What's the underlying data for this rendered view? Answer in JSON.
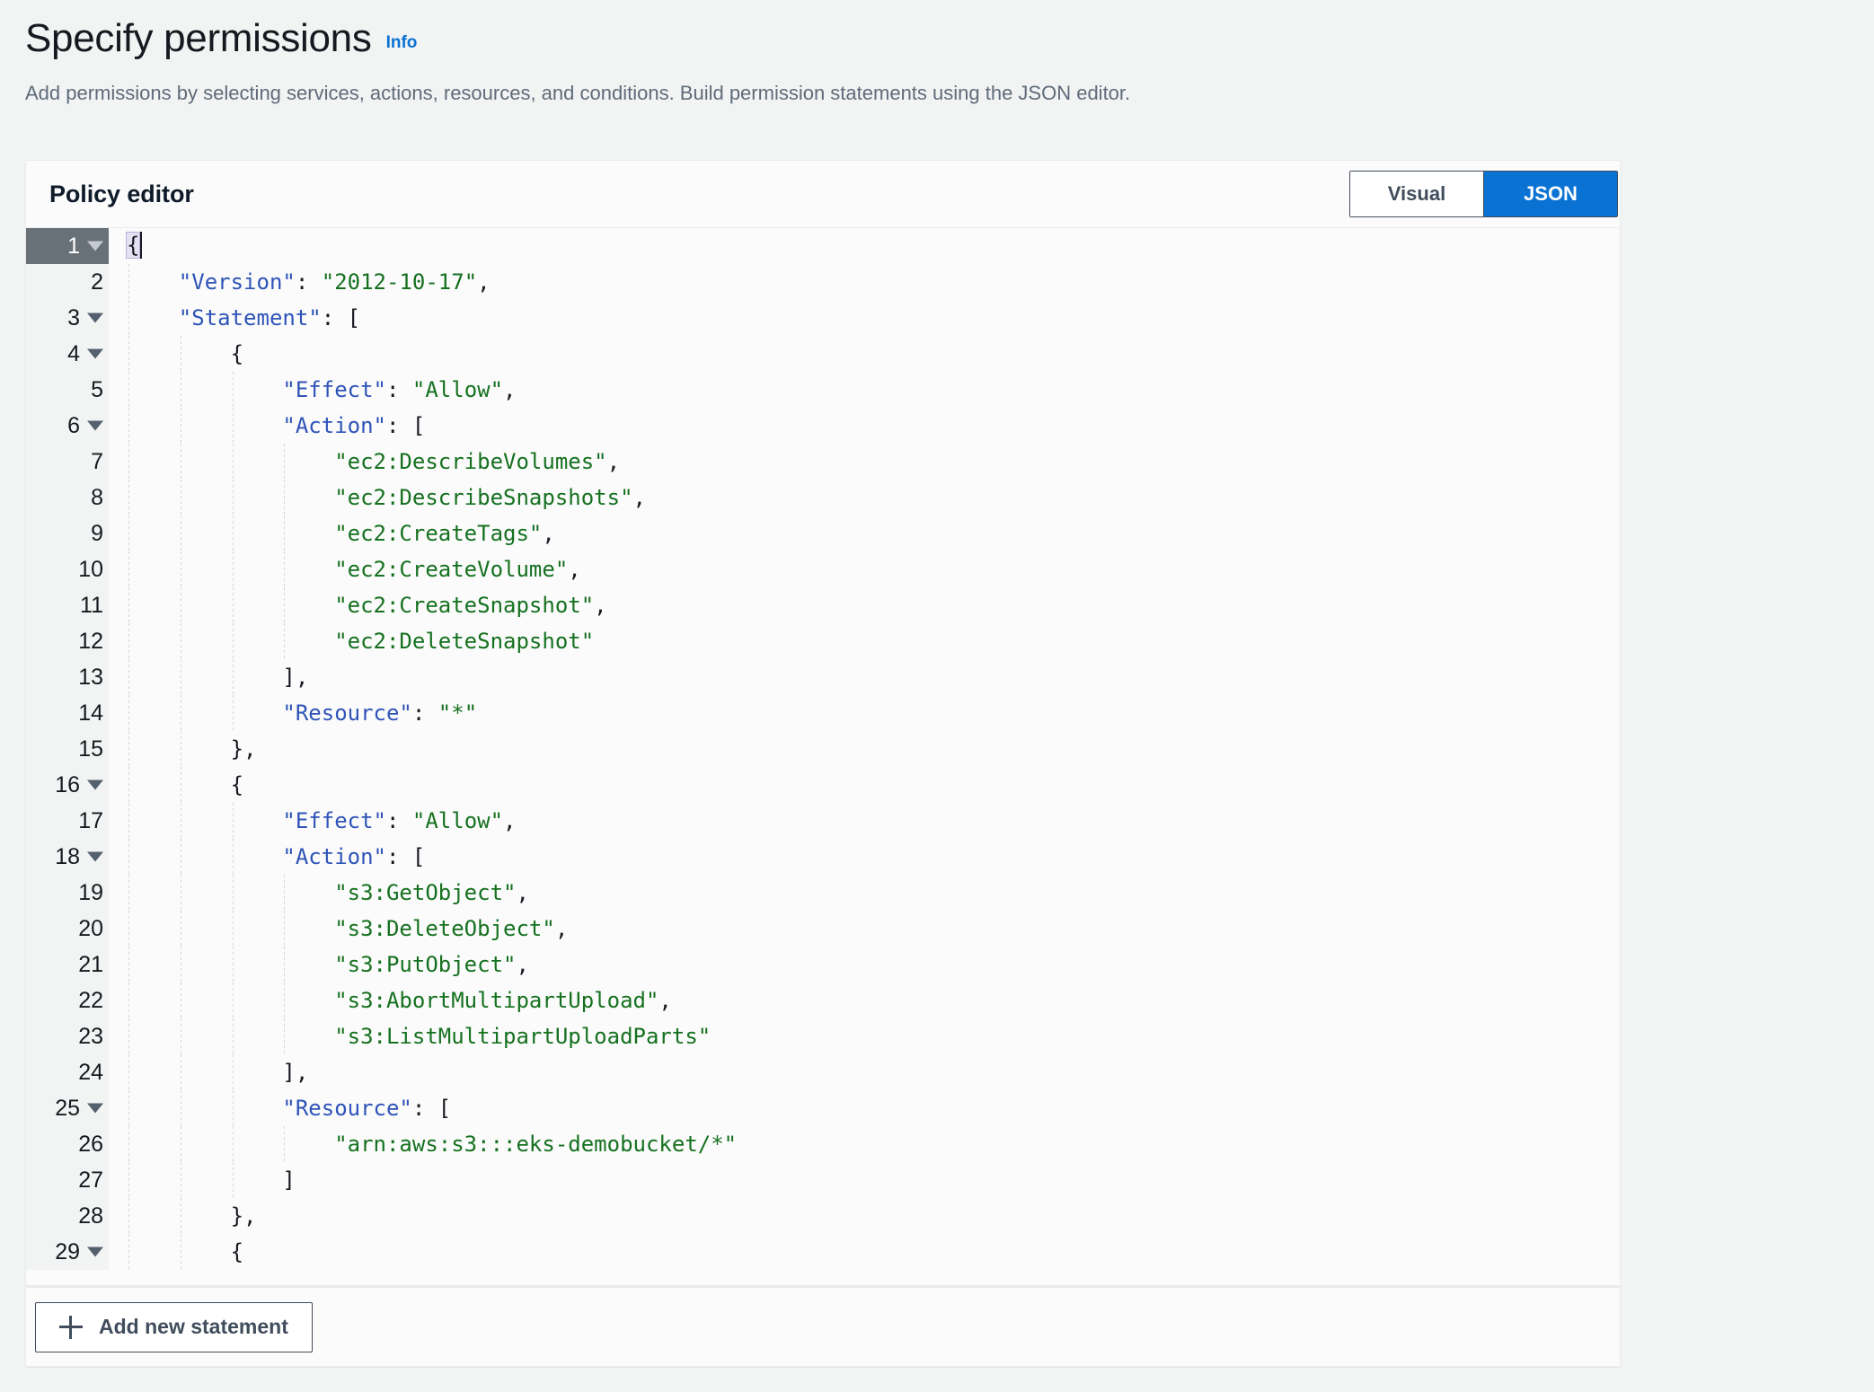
{
  "header": {
    "title": "Specify permissions",
    "info_label": "Info",
    "subtitle": "Add permissions by selecting services, actions, resources, and conditions. Build permission statements using the JSON editor."
  },
  "policy_editor": {
    "heading": "Policy editor",
    "mode_toggle": {
      "options": [
        "Visual",
        "JSON"
      ],
      "visual_label": "Visual",
      "json_label": "JSON",
      "selected": "JSON",
      "active_color": "#0972d3",
      "inactive_color": "#ffffff"
    },
    "footer": {
      "add_statement_label": "Add new statement",
      "add_icon": "plus-icon"
    },
    "syntax_colors": {
      "key": "#2f54b8",
      "string": "#15711f",
      "punctuation": "#16191f",
      "gutter_bg": "#f2f3f3",
      "active_line_bg": "#687078"
    },
    "active_line": 1,
    "lines": [
      {
        "n": 1,
        "indent": 0,
        "fold": true,
        "text": "{",
        "active": true
      },
      {
        "n": 2,
        "indent": 1,
        "fold": false,
        "text": "\"Version\": \"2012-10-17\","
      },
      {
        "n": 3,
        "indent": 1,
        "fold": true,
        "text": "\"Statement\": ["
      },
      {
        "n": 4,
        "indent": 2,
        "fold": true,
        "text": "{"
      },
      {
        "n": 5,
        "indent": 3,
        "fold": false,
        "text": "\"Effect\": \"Allow\","
      },
      {
        "n": 6,
        "indent": 3,
        "fold": true,
        "text": "\"Action\": ["
      },
      {
        "n": 7,
        "indent": 4,
        "fold": false,
        "text": "\"ec2:DescribeVolumes\","
      },
      {
        "n": 8,
        "indent": 4,
        "fold": false,
        "text": "\"ec2:DescribeSnapshots\","
      },
      {
        "n": 9,
        "indent": 4,
        "fold": false,
        "text": "\"ec2:CreateTags\","
      },
      {
        "n": 10,
        "indent": 4,
        "fold": false,
        "text": "\"ec2:CreateVolume\","
      },
      {
        "n": 11,
        "indent": 4,
        "fold": false,
        "text": "\"ec2:CreateSnapshot\","
      },
      {
        "n": 12,
        "indent": 4,
        "fold": false,
        "text": "\"ec2:DeleteSnapshot\""
      },
      {
        "n": 13,
        "indent": 3,
        "fold": false,
        "text": "],"
      },
      {
        "n": 14,
        "indent": 3,
        "fold": false,
        "text": "\"Resource\": \"*\""
      },
      {
        "n": 15,
        "indent": 2,
        "fold": false,
        "text": "},"
      },
      {
        "n": 16,
        "indent": 2,
        "fold": true,
        "text": "{"
      },
      {
        "n": 17,
        "indent": 3,
        "fold": false,
        "text": "\"Effect\": \"Allow\","
      },
      {
        "n": 18,
        "indent": 3,
        "fold": true,
        "text": "\"Action\": ["
      },
      {
        "n": 19,
        "indent": 4,
        "fold": false,
        "text": "\"s3:GetObject\","
      },
      {
        "n": 20,
        "indent": 4,
        "fold": false,
        "text": "\"s3:DeleteObject\","
      },
      {
        "n": 21,
        "indent": 4,
        "fold": false,
        "text": "\"s3:PutObject\","
      },
      {
        "n": 22,
        "indent": 4,
        "fold": false,
        "text": "\"s3:AbortMultipartUpload\","
      },
      {
        "n": 23,
        "indent": 4,
        "fold": false,
        "text": "\"s3:ListMultipartUploadParts\""
      },
      {
        "n": 24,
        "indent": 3,
        "fold": false,
        "text": "],"
      },
      {
        "n": 25,
        "indent": 3,
        "fold": true,
        "text": "\"Resource\": ["
      },
      {
        "n": 26,
        "indent": 4,
        "fold": false,
        "text": "\"arn:aws:s3:::eks-demobucket/*\""
      },
      {
        "n": 27,
        "indent": 3,
        "fold": false,
        "text": "]"
      },
      {
        "n": 28,
        "indent": 2,
        "fold": false,
        "text": "},"
      },
      {
        "n": 29,
        "indent": 2,
        "fold": true,
        "text": "{"
      }
    ]
  }
}
